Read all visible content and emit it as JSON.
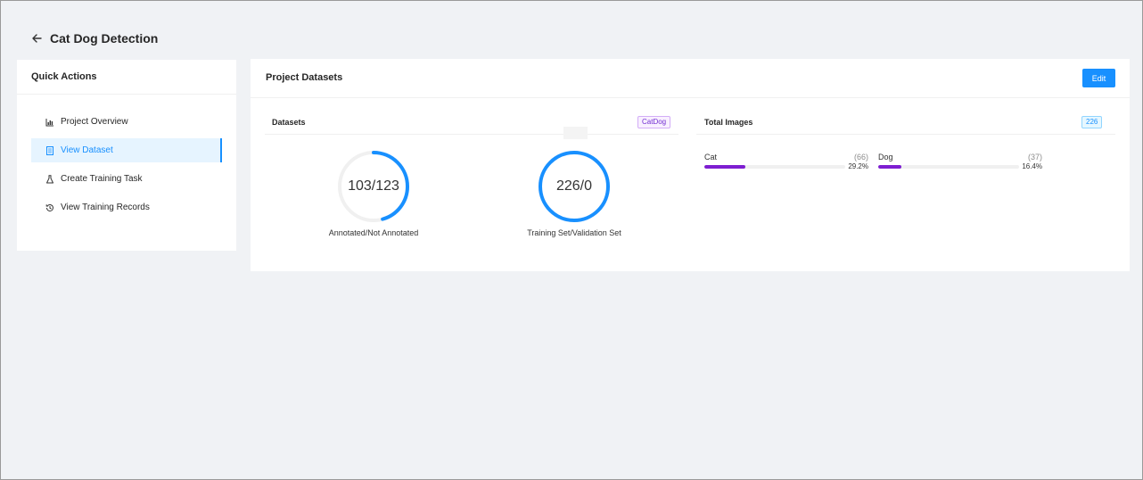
{
  "header": {
    "title": "Cat Dog Detection"
  },
  "quick_actions": {
    "title": "Quick Actions",
    "items": [
      {
        "label": "Project Overview",
        "icon": "bar-chart-icon",
        "active": false
      },
      {
        "label": "View Dataset",
        "icon": "document-icon",
        "active": true
      },
      {
        "label": "Create Training Task",
        "icon": "flask-icon",
        "active": false
      },
      {
        "label": "View Training Records",
        "icon": "history-icon",
        "active": false
      }
    ]
  },
  "project_datasets": {
    "title": "Project Datasets",
    "edit_label": "Edit",
    "datasets": {
      "title": "Datasets",
      "tag": "CatDog",
      "rings": [
        {
          "value_text": "103/123",
          "label": "Annotated/Not Annotated",
          "fraction": 0.456,
          "color": "#1890ff"
        },
        {
          "value_text": "226/0",
          "label": "Training Set/Validation Set",
          "fraction": 1.0,
          "color": "#1890ff"
        }
      ]
    },
    "total_images": {
      "title": "Total Images",
      "count": "226",
      "classes": [
        {
          "name": "Cat",
          "count": "(66)",
          "percent": "29.2%",
          "fraction": 0.292
        },
        {
          "name": "Dog",
          "count": "(37)",
          "percent": "16.4%",
          "fraction": 0.164
        }
      ]
    }
  },
  "colors": {
    "accent": "#1890ff",
    "class_bar": "#7e1ed1",
    "tag_purple": "#722ed1"
  }
}
